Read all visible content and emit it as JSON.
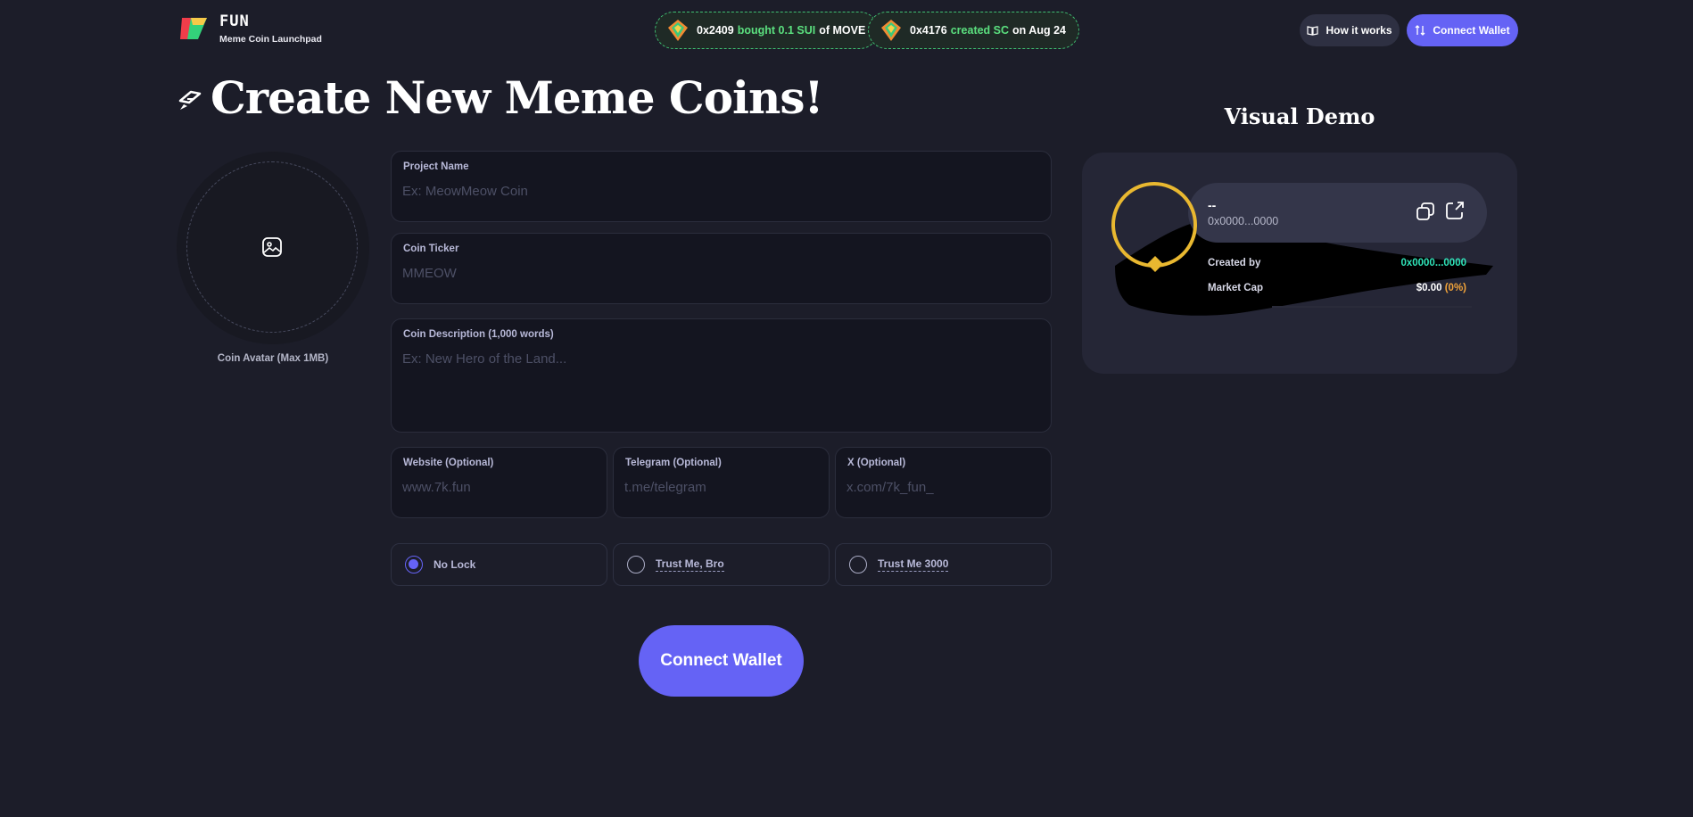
{
  "header": {
    "brand_name": "FUN",
    "brand_sub": "Meme Coin Launchpad",
    "tickers": [
      {
        "address": "0x2409",
        "action": "bought 0.1 SUI",
        "suffix": "of MOVE"
      },
      {
        "address": "0x4176",
        "action": "created SC",
        "suffix": "on Aug 24"
      }
    ],
    "how_it_works_label": "How it works",
    "connect_wallet_label": "Connect Wallet"
  },
  "page_title": "Create New Meme Coins!",
  "avatar": {
    "label": "Coin Avatar (Max 1MB)"
  },
  "form": {
    "project_name": {
      "label": "Project Name",
      "placeholder": "Ex: MeowMeow Coin",
      "value": ""
    },
    "coin_ticker": {
      "label": "Coin Ticker",
      "placeholder": "MMEOW",
      "value": ""
    },
    "coin_description": {
      "label": "Coin Description (1,000 words)",
      "placeholder": "Ex: New Hero of the Land...",
      "value": ""
    },
    "website": {
      "label": "Website (Optional)",
      "placeholder": "www.7k.fun",
      "value": ""
    },
    "telegram": {
      "label": "Telegram (Optional)",
      "placeholder": "t.me/telegram",
      "value": ""
    },
    "x": {
      "label": "X (Optional)",
      "placeholder": "x.com/7k_fun_",
      "value": ""
    },
    "lock_options": [
      {
        "label": "No Lock",
        "selected": true
      },
      {
        "label": "Trust Me, Bro",
        "selected": false
      },
      {
        "label": "Trust Me 3000",
        "selected": false
      }
    ],
    "connect_wallet_label": "Connect Wallet"
  },
  "demo": {
    "title": "Visual Demo",
    "coin_name": "--",
    "coin_address": "0x0000...0000",
    "created_by_label": "Created by",
    "created_by_value": "0x0000...0000",
    "market_cap_label": "Market Cap",
    "market_cap_value": "$0.00",
    "market_cap_change": "(0%)"
  },
  "colors": {
    "background": "#1c1d29",
    "accent": "#6563f5",
    "ticker_highlight": "#5be07f",
    "demo_addr": "#2fe3b8",
    "demo_change": "#f2a33a",
    "ring": "#e9b830"
  },
  "icons": {
    "logo": "7k-logo-icon",
    "gem": "gem-icon",
    "book": "book-icon",
    "swap": "swap-icon",
    "title": "pen-icon",
    "image": "image-upload-icon",
    "copy": "copy-icon",
    "external": "external-link-icon"
  }
}
